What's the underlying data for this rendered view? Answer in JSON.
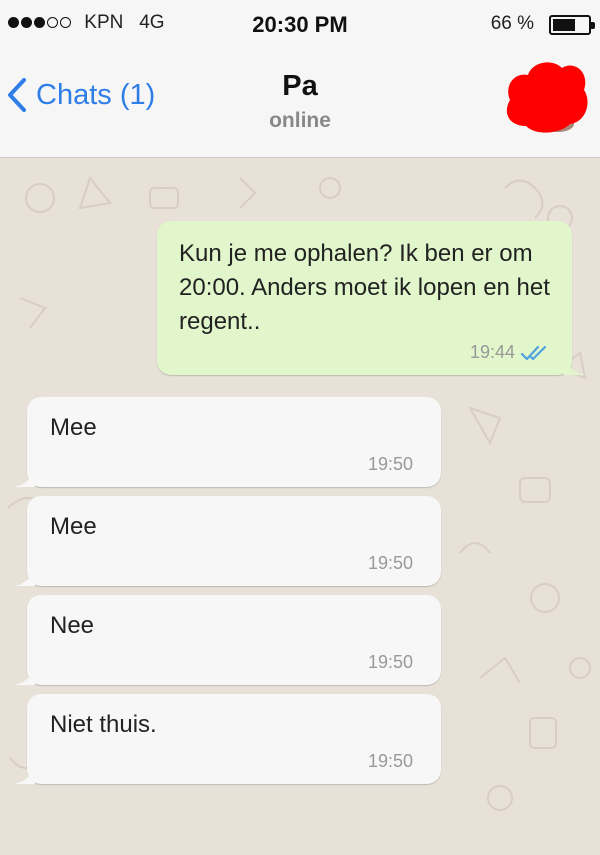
{
  "status_bar": {
    "carrier": "KPN",
    "network": "4G",
    "time": "20:30 PM",
    "battery_percent": "66 %",
    "battery_level": 0.66,
    "signal_bars": 3,
    "signal_total": 5
  },
  "nav": {
    "back_label": "Chats (1)",
    "contact_name": "Pa",
    "contact_status": "online"
  },
  "colors": {
    "accent": "#2f7ee8",
    "outgoing_bubble": "#e1f7cb",
    "incoming_bubble": "#f7f7f7",
    "read_ticks": "#4fa3e0",
    "avatar_redaction": "#ff0000"
  },
  "messages": [
    {
      "direction": "outgoing",
      "text": "Kun je me ophalen? Ik ben er om 20:00. Anders moet ik lopen en het regent..",
      "time": "19:44",
      "read_ticks": "double-check-icon"
    },
    {
      "direction": "incoming",
      "text": "Mee",
      "time": "19:50"
    },
    {
      "direction": "incoming",
      "text": "Mee",
      "time": "19:50"
    },
    {
      "direction": "incoming",
      "text": "Nee",
      "time": "19:50"
    },
    {
      "direction": "incoming",
      "text": "Niet thuis.",
      "time": "19:50"
    }
  ]
}
